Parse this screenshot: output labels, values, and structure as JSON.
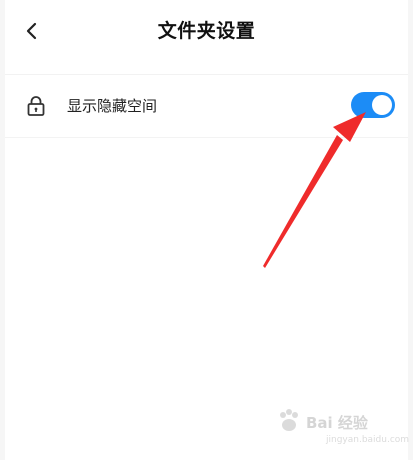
{
  "header": {
    "back_icon": "chevron-left-icon",
    "title": "文件夹设置"
  },
  "settings": {
    "show_hidden_space": {
      "icon": "lock-icon",
      "label": "显示隐藏空间",
      "enabled": true,
      "accent_color": "#1c8cf6"
    }
  },
  "annotation": {
    "arrow_color": "#ef2b2b"
  },
  "watermark": {
    "text": "Bai 经验",
    "url": "jingyan.baidu.com"
  }
}
